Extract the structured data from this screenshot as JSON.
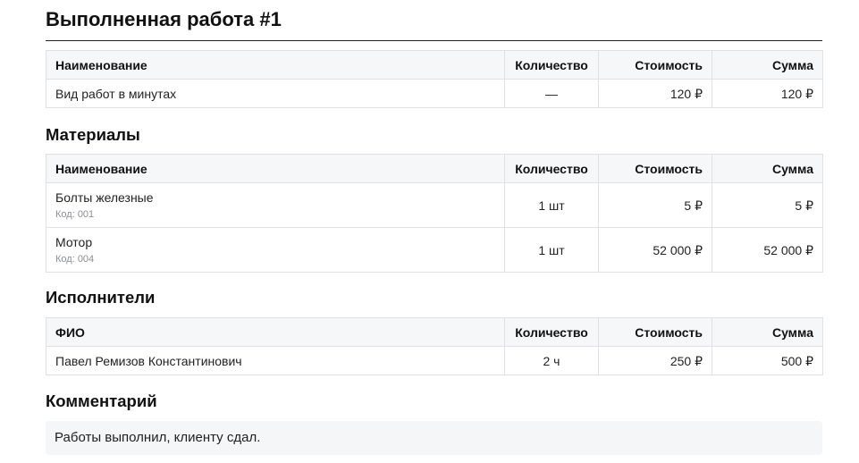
{
  "page": {
    "title": "Выполненная работа #1"
  },
  "work": {
    "headers": {
      "name": "Наименование",
      "qty": "Количество",
      "cost": "Стоимость",
      "sum": "Сумма"
    },
    "rows": [
      {
        "name": "Вид работ в минутах",
        "qty": "—",
        "cost": "120 ₽",
        "sum": "120 ₽"
      }
    ]
  },
  "materials": {
    "title": "Материалы",
    "headers": {
      "name": "Наименование",
      "qty": "Количество",
      "cost": "Стоимость",
      "sum": "Сумма"
    },
    "rows": [
      {
        "name": "Болты железные",
        "code": "Код: 001",
        "qty": "1 шт",
        "cost": "5 ₽",
        "sum": "5 ₽"
      },
      {
        "name": "Мотор",
        "code": "Код: 004",
        "qty": "1 шт",
        "cost": "52 000 ₽",
        "sum": "52 000 ₽"
      }
    ]
  },
  "executors": {
    "title": "Исполнители",
    "headers": {
      "name": "ФИО",
      "qty": "Количество",
      "cost": "Стоимость",
      "sum": "Сумма"
    },
    "rows": [
      {
        "name": "Павел Ремизов Константинович",
        "qty": "2 ч",
        "cost": "250 ₽",
        "sum": "500 ₽"
      }
    ]
  },
  "comment": {
    "title": "Комментарий",
    "text": "Работы выполнил, клиенту сдал."
  }
}
